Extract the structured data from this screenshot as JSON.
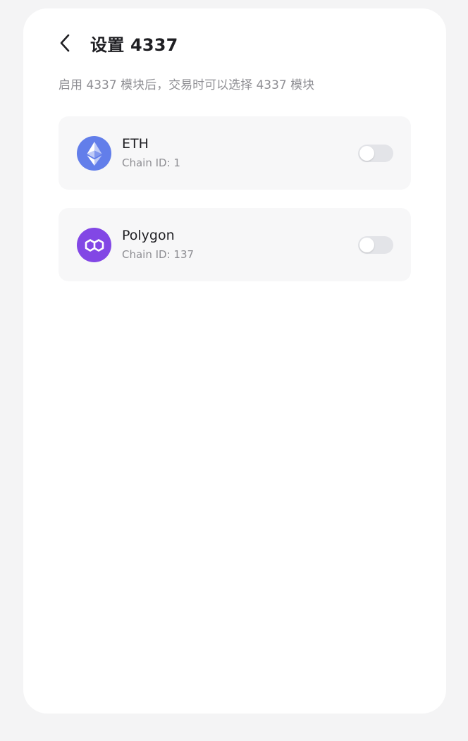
{
  "header": {
    "title": "设置 4337",
    "back_icon": "chevron-left-icon"
  },
  "description": "启用 4337 模块后，交易时可以选择 4337 模块",
  "chains": [
    {
      "name": "ETH",
      "chain_id_text": "Chain ID: 1",
      "icon": "ethereum-icon",
      "icon_color": "#627eea",
      "enabled": false
    },
    {
      "name": "Polygon",
      "chain_id_text": "Chain ID: 137",
      "icon": "polygon-icon",
      "icon_color": "#8247e5",
      "enabled": false
    }
  ],
  "colors": {
    "background": "#f4f4f5",
    "card": "#ffffff",
    "row": "#f7f7f8",
    "toggle_off": "#e3e4e8"
  }
}
